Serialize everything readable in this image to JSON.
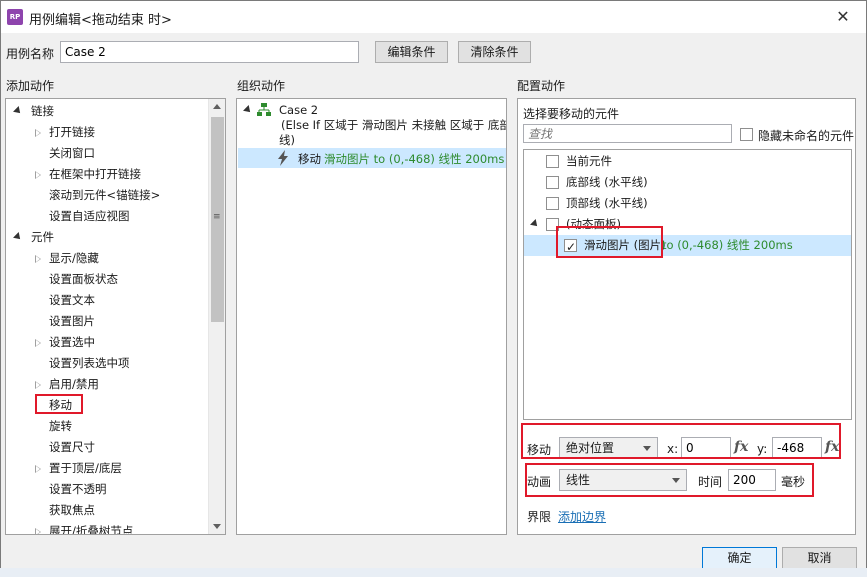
{
  "window": {
    "title": "用例编辑<拖动结束 时>",
    "app_icon_text": "RP",
    "close_glyph": "✕"
  },
  "case_name": {
    "label": "用例名称",
    "value": "Case 2",
    "edit_condition": "编辑条件",
    "clear_condition": "清除条件"
  },
  "add_actions": {
    "header": "添加动作",
    "tree": [
      {
        "label": "链接",
        "level": 0,
        "expander": "open"
      },
      {
        "label": "打开链接",
        "level": 1,
        "expander": "closed"
      },
      {
        "label": "关闭窗口",
        "level": 1,
        "expander": "none"
      },
      {
        "label": "在框架中打开链接",
        "level": 1,
        "expander": "closed"
      },
      {
        "label": "滚动到元件<锚链接>",
        "level": 1,
        "expander": "none"
      },
      {
        "label": "设置自适应视图",
        "level": 1,
        "expander": "none"
      },
      {
        "label": "元件",
        "level": 0,
        "expander": "open"
      },
      {
        "label": "显示/隐藏",
        "level": 1,
        "expander": "closed"
      },
      {
        "label": "设置面板状态",
        "level": 1,
        "expander": "none"
      },
      {
        "label": "设置文本",
        "level": 1,
        "expander": "none"
      },
      {
        "label": "设置图片",
        "level": 1,
        "expander": "none"
      },
      {
        "label": "设置选中",
        "level": 1,
        "expander": "closed"
      },
      {
        "label": "设置列表选中项",
        "level": 1,
        "expander": "none"
      },
      {
        "label": "启用/禁用",
        "level": 1,
        "expander": "closed"
      },
      {
        "label": "移动",
        "level": 1,
        "expander": "none"
      },
      {
        "label": "旋转",
        "level": 1,
        "expander": "none"
      },
      {
        "label": "设置尺寸",
        "level": 1,
        "expander": "none"
      },
      {
        "label": "置于顶层/底层",
        "level": 1,
        "expander": "closed"
      },
      {
        "label": "设置不透明",
        "level": 1,
        "expander": "none"
      },
      {
        "label": "获取焦点",
        "level": 1,
        "expander": "none"
      },
      {
        "label": "展开/折叠树节点",
        "level": 1,
        "expander": "closed"
      }
    ]
  },
  "organize_actions": {
    "header": "组织动作",
    "case_title": "Case 2",
    "case_condition_line1": "(Else If 区域于 滑动图片 未接触 区域于 底部",
    "case_condition_line2": "线)",
    "action_prefix": "移动 ",
    "action_detail": "滑动图片 to (0,-468) 线性 200ms"
  },
  "config": {
    "header": "配置动作",
    "select_label": "选择要移动的元件",
    "search_placeholder": "查找",
    "hide_unnamed": "隐藏未命名的元件",
    "widgets": [
      {
        "label": "当前元件",
        "checked": false,
        "indent": 0
      },
      {
        "label": "底部线 (水平线)",
        "checked": false,
        "indent": 0
      },
      {
        "label": "顶部线 (水平线)",
        "checked": false,
        "indent": 0
      },
      {
        "label": "(动态面板)",
        "checked": false,
        "indent": 0,
        "expander": true
      },
      {
        "label": "滑动图片 (图片)",
        "checked": true,
        "indent": 1,
        "detail": " to (0,-468) 线性 200ms"
      }
    ],
    "move": {
      "label": "移动",
      "mode": "绝对位置",
      "x_label": "x:",
      "x_value": "0",
      "y_label": "y:",
      "y_value": "-468",
      "fx": "fx"
    },
    "animation": {
      "label": "动画",
      "easing": "线性",
      "time_label": "时间",
      "time_value": "200",
      "unit": "毫秒"
    },
    "bounds": {
      "label": "界限",
      "link": "添加边界"
    }
  },
  "footer": {
    "ok": "确定",
    "cancel": "取消"
  },
  "colors": {
    "accent_red": "#e0192a",
    "action_green": "#2e8b2e",
    "selection_blue": "#cce8ff"
  }
}
